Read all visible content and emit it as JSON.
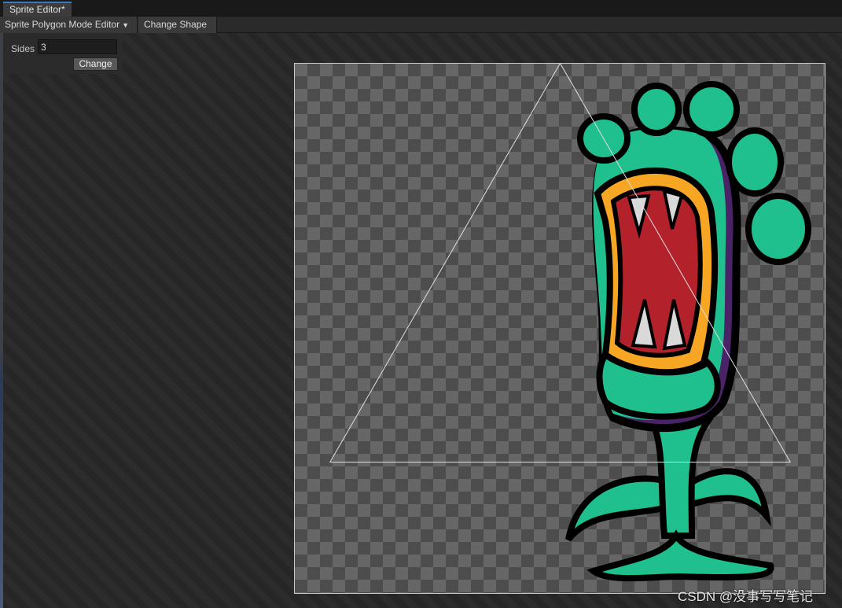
{
  "window": {
    "tab_title": "Sprite Editor*"
  },
  "toolbar": {
    "mode_dropdown": "Sprite Polygon Mode Editor",
    "change_shape_label": "Change Shape"
  },
  "shape_panel": {
    "sides_label": "Sides",
    "sides_value": "3",
    "change_label": "Change"
  },
  "sprite": {
    "outline_sides": 3,
    "colors": {
      "body": "#1fbf8e",
      "shadow": "#4a2266",
      "lip": "#f6a623",
      "mouth": "#b3212b",
      "teeth": "#d9d9d9",
      "outline": "#000000"
    }
  },
  "watermark": "CSDN @没事写写笔记"
}
